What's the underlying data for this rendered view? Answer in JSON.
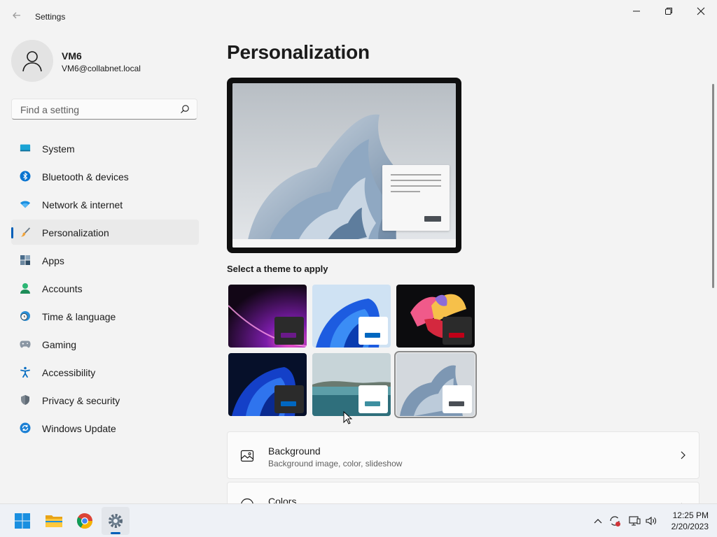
{
  "window": {
    "title": "Settings"
  },
  "profile": {
    "name": "VM6",
    "email": "VM6@collabnet.local"
  },
  "search": {
    "placeholder": "Find a setting"
  },
  "nav": {
    "items": [
      {
        "label": "System",
        "icon": "system-icon"
      },
      {
        "label": "Bluetooth & devices",
        "icon": "bluetooth-icon"
      },
      {
        "label": "Network & internet",
        "icon": "wifi-icon"
      },
      {
        "label": "Personalization",
        "icon": "brush-icon",
        "active": true
      },
      {
        "label": "Apps",
        "icon": "apps-icon"
      },
      {
        "label": "Accounts",
        "icon": "accounts-icon"
      },
      {
        "label": "Time & language",
        "icon": "clock-globe-icon"
      },
      {
        "label": "Gaming",
        "icon": "gamepad-icon"
      },
      {
        "label": "Accessibility",
        "icon": "accessibility-icon"
      },
      {
        "label": "Privacy & security",
        "icon": "shield-icon"
      },
      {
        "label": "Windows Update",
        "icon": "windows-update-icon"
      }
    ]
  },
  "main": {
    "title": "Personalization",
    "themes_label": "Select a theme to apply",
    "themes": [
      {
        "name": "glow",
        "accent": "#6b1a8a",
        "mini_bg": "#2b2b2b"
      },
      {
        "name": "windows-light",
        "accent": "#0067c0",
        "mini_bg": "#ffffff"
      },
      {
        "name": "captured-motion",
        "accent": "#c00018",
        "mini_bg": "#2b2b2b"
      },
      {
        "name": "windows-dark",
        "accent": "#0067c0",
        "mini_bg": "#2b2b2b"
      },
      {
        "name": "sunrise-lake",
        "accent": "#3d8fa0",
        "mini_bg": "#ffffff"
      },
      {
        "name": "flow",
        "accent": "#4a4f55",
        "mini_bg": "#ffffff",
        "selected": true
      }
    ],
    "cards": [
      {
        "title": "Background",
        "subtitle": "Background image, color, slideshow",
        "icon": "image-icon"
      },
      {
        "title": "Colors",
        "subtitle": "",
        "icon": "palette-icon"
      }
    ]
  },
  "taskbar": {
    "apps": [
      "start-icon",
      "file-explorer-icon",
      "chrome-icon",
      "settings-icon"
    ],
    "time": "12:25 PM",
    "date": "2/20/2023"
  },
  "colors": {
    "accent": "#005fb8",
    "background": "#f3f3f3"
  }
}
